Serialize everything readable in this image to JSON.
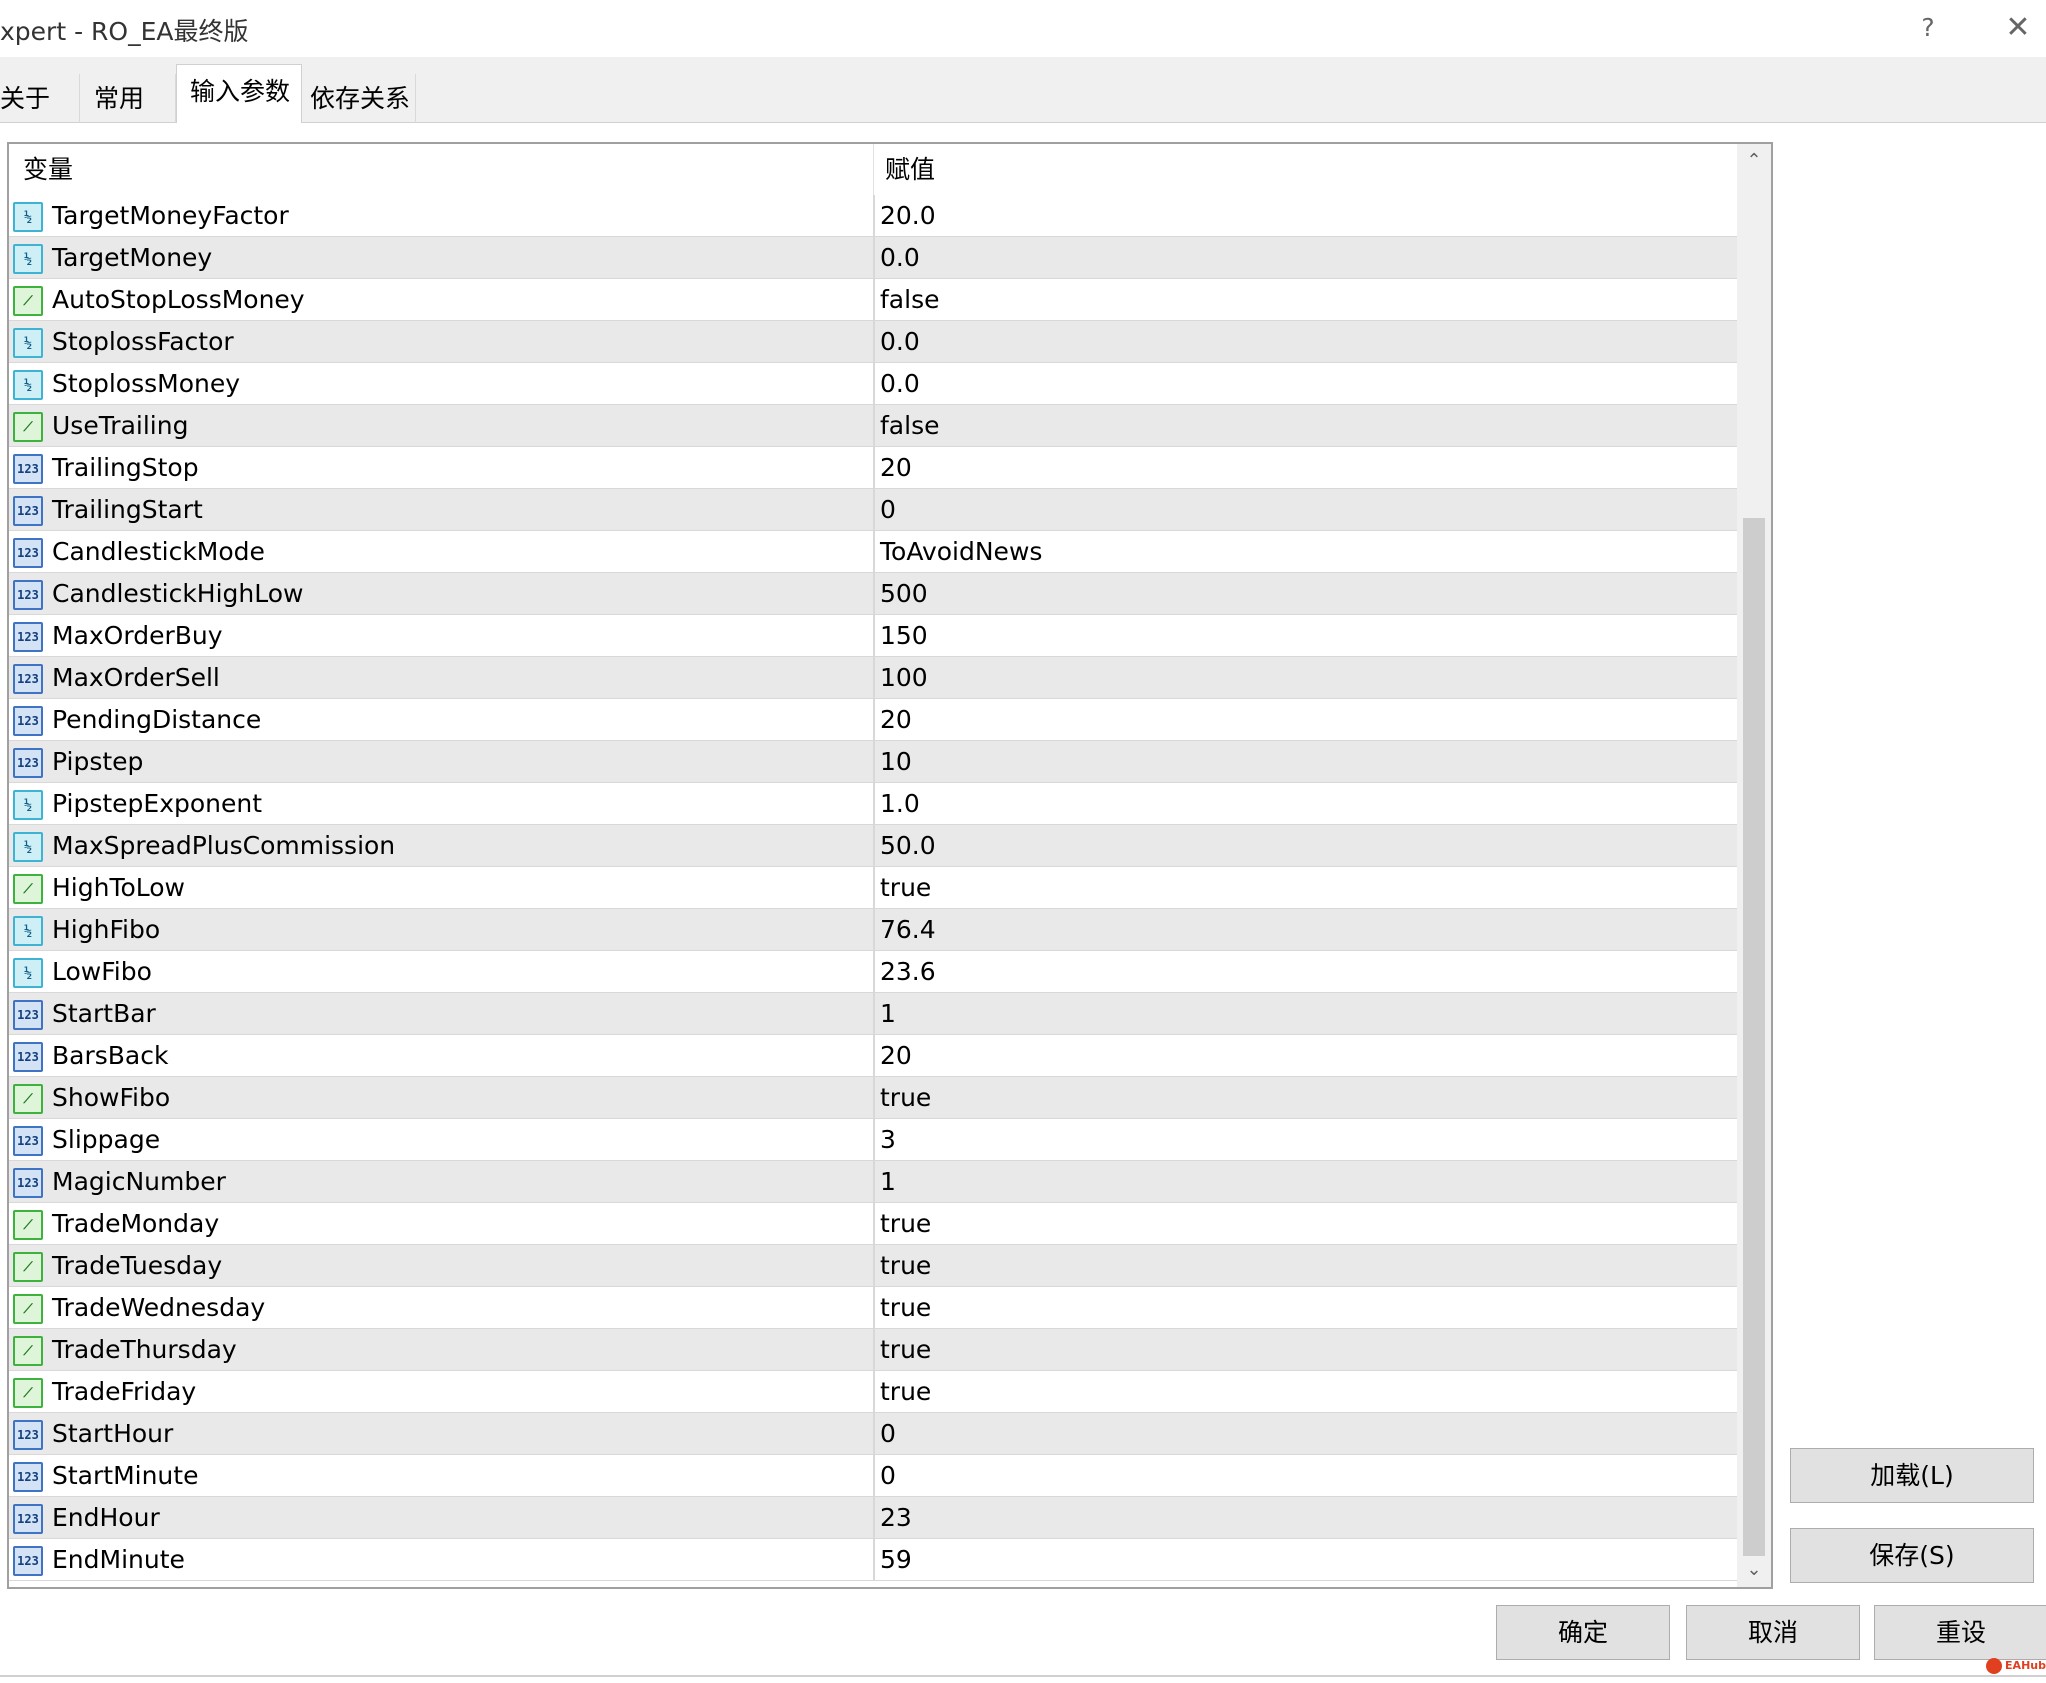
{
  "window": {
    "title": "xpert - RO_EA最终版",
    "help": "?",
    "close": "✕"
  },
  "tabs": [
    {
      "label": "关于"
    },
    {
      "label": "常用"
    },
    {
      "label": "输入参数",
      "active": true
    },
    {
      "label": "依存关系"
    }
  ],
  "table": {
    "header_name": "变量",
    "header_value": "赋值",
    "rows": [
      {
        "type": "double",
        "name": "TargetMoneyFactor",
        "value": "20.0"
      },
      {
        "type": "double",
        "name": "TargetMoney",
        "value": "0.0"
      },
      {
        "type": "bool",
        "name": "AutoStopLossMoney",
        "value": "false"
      },
      {
        "type": "double",
        "name": "StoplossFactor",
        "value": "0.0"
      },
      {
        "type": "double",
        "name": "StoplossMoney",
        "value": "0.0"
      },
      {
        "type": "bool",
        "name": "UseTrailing",
        "value": "false"
      },
      {
        "type": "int",
        "name": "TrailingStop",
        "value": "20"
      },
      {
        "type": "int",
        "name": "TrailingStart",
        "value": "0"
      },
      {
        "type": "int",
        "name": "CandlestickMode",
        "value": "ToAvoidNews"
      },
      {
        "type": "int",
        "name": "CandlestickHighLow",
        "value": "500"
      },
      {
        "type": "int",
        "name": "MaxOrderBuy",
        "value": "150"
      },
      {
        "type": "int",
        "name": "MaxOrderSell",
        "value": "100"
      },
      {
        "type": "int",
        "name": "PendingDistance",
        "value": "20"
      },
      {
        "type": "int",
        "name": "Pipstep",
        "value": "10"
      },
      {
        "type": "double",
        "name": "PipstepExponent",
        "value": "1.0"
      },
      {
        "type": "double",
        "name": "MaxSpreadPlusCommission",
        "value": "50.0"
      },
      {
        "type": "bool",
        "name": "HighToLow",
        "value": "true"
      },
      {
        "type": "double",
        "name": "HighFibo",
        "value": "76.4"
      },
      {
        "type": "double",
        "name": "LowFibo",
        "value": "23.6"
      },
      {
        "type": "int",
        "name": "StartBar",
        "value": "1"
      },
      {
        "type": "int",
        "name": "BarsBack",
        "value": "20"
      },
      {
        "type": "bool",
        "name": "ShowFibo",
        "value": "true"
      },
      {
        "type": "int",
        "name": "Slippage",
        "value": "3"
      },
      {
        "type": "int",
        "name": "MagicNumber",
        "value": "1"
      },
      {
        "type": "bool",
        "name": "TradeMonday",
        "value": "true"
      },
      {
        "type": "bool",
        "name": "TradeTuesday",
        "value": "true"
      },
      {
        "type": "bool",
        "name": "TradeWednesday",
        "value": "true"
      },
      {
        "type": "bool",
        "name": "TradeThursday",
        "value": "true"
      },
      {
        "type": "bool",
        "name": "TradeFriday",
        "value": "true"
      },
      {
        "type": "int",
        "name": "StartHour",
        "value": "0"
      },
      {
        "type": "int",
        "name": "StartMinute",
        "value": "0"
      },
      {
        "type": "int",
        "name": "EndHour",
        "value": "23"
      },
      {
        "type": "int",
        "name": "EndMinute",
        "value": "59"
      }
    ]
  },
  "icons": {
    "double": {
      "name": "double-type-icon",
      "glyph": "½"
    },
    "bool": {
      "name": "bool-type-icon",
      "glyph": "⟋"
    },
    "int": {
      "name": "int-type-icon",
      "glyph": "123"
    }
  },
  "scrollbar": {
    "up": "⌃",
    "down": "⌄"
  },
  "buttons": {
    "load": "加载(L)",
    "save": "保存(S)",
    "ok": "确定",
    "cancel": "取消",
    "reset": "重设"
  },
  "watermark": "EAHub"
}
